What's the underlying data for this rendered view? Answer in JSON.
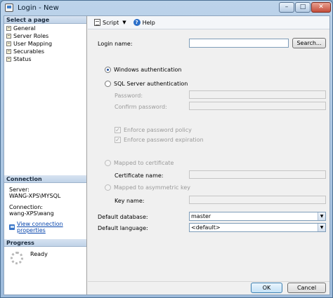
{
  "window": {
    "title": "Login - New",
    "min_glyph": "–",
    "max_glyph": "□",
    "close_glyph": "✕"
  },
  "left_panel": {
    "select_header": "Select a page",
    "pages": [
      "General",
      "Server Roles",
      "User Mapping",
      "Securables",
      "Status"
    ],
    "connection_header": "Connection",
    "server_label": "Server:",
    "server_value": "WANG-XPS\\MYSQL",
    "connection_label": "Connection:",
    "connection_value": "wang-XPS\\wang",
    "view_link": "View connection properties",
    "progress_header": "Progress",
    "progress_status": "Ready"
  },
  "toolbar": {
    "script_label": "Script",
    "help_label": "Help",
    "dropdown_glyph": "▼",
    "help_glyph": "?"
  },
  "form": {
    "login_name_label": "Login name:",
    "login_name_value": "",
    "search_button": "Search...",
    "windows_auth": "Windows authentication",
    "sql_auth": "SQL Server authentication",
    "password_label": "Password:",
    "confirm_password_label": "Confirm password:",
    "enforce_policy": "Enforce password policy",
    "enforce_expiration": "Enforce password expiration",
    "check_glyph": "✓",
    "mapped_cert": "Mapped to certificate",
    "certificate_name_label": "Certificate name:",
    "mapped_asym_key": "Mapped to asymmetric key",
    "key_name_label": "Key name:",
    "default_db_label": "Default database:",
    "default_db_value": "master",
    "default_lang_label": "Default language:",
    "default_lang_value": "<default>",
    "select_arrow": "▼"
  },
  "footer": {
    "ok": "OK",
    "cancel": "Cancel"
  }
}
